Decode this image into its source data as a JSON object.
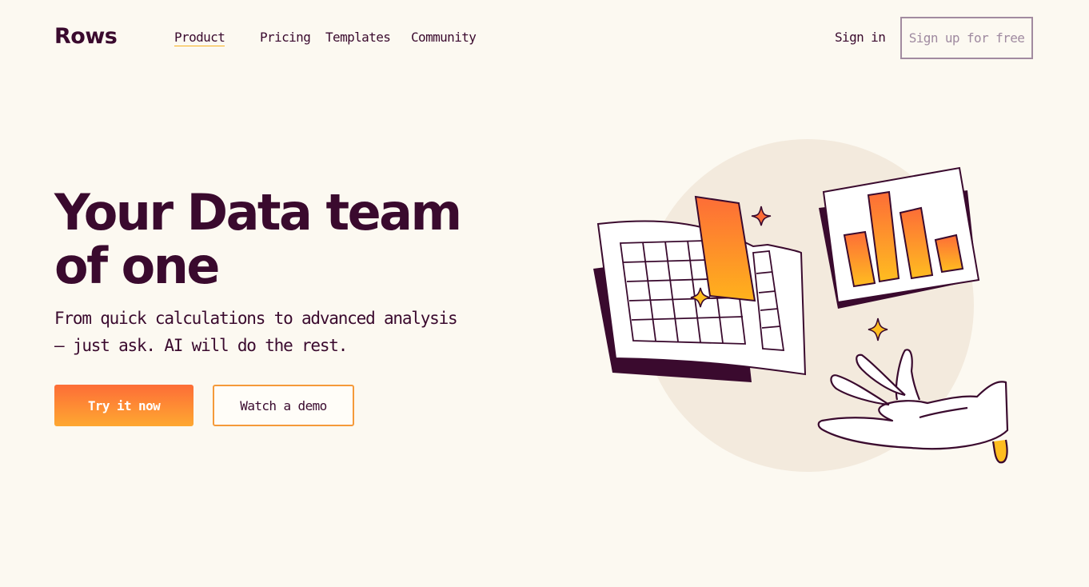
{
  "brand": {
    "logo": "Rows"
  },
  "nav": {
    "items": [
      {
        "label": "Product",
        "active": true
      },
      {
        "label": "Pricing",
        "active": false
      },
      {
        "label": "Templates",
        "active": false
      },
      {
        "label": "Community",
        "active": false
      }
    ],
    "sign_in": "Sign in",
    "sign_up": "Sign up for free"
  },
  "hero": {
    "title": "Your Data team of one",
    "subtitle": "From quick calculations to advanced analysis — just ask. AI will do the rest.",
    "primary_cta": "Try it now",
    "secondary_cta": "Watch a demo"
  },
  "colors": {
    "ink": "#3a0a2e",
    "background": "#fcf9f1",
    "accent_orange": "#fd6d37",
    "accent_yellow": "#fea831",
    "circle": "#f3eadd"
  },
  "illustration": {
    "icons": [
      "spreadsheet-icon",
      "bar-chart-icon",
      "sparkle-icon",
      "hand-icon"
    ],
    "bar_chart": {
      "values": [
        0.55,
        0.92,
        0.72,
        0.35
      ]
    }
  }
}
